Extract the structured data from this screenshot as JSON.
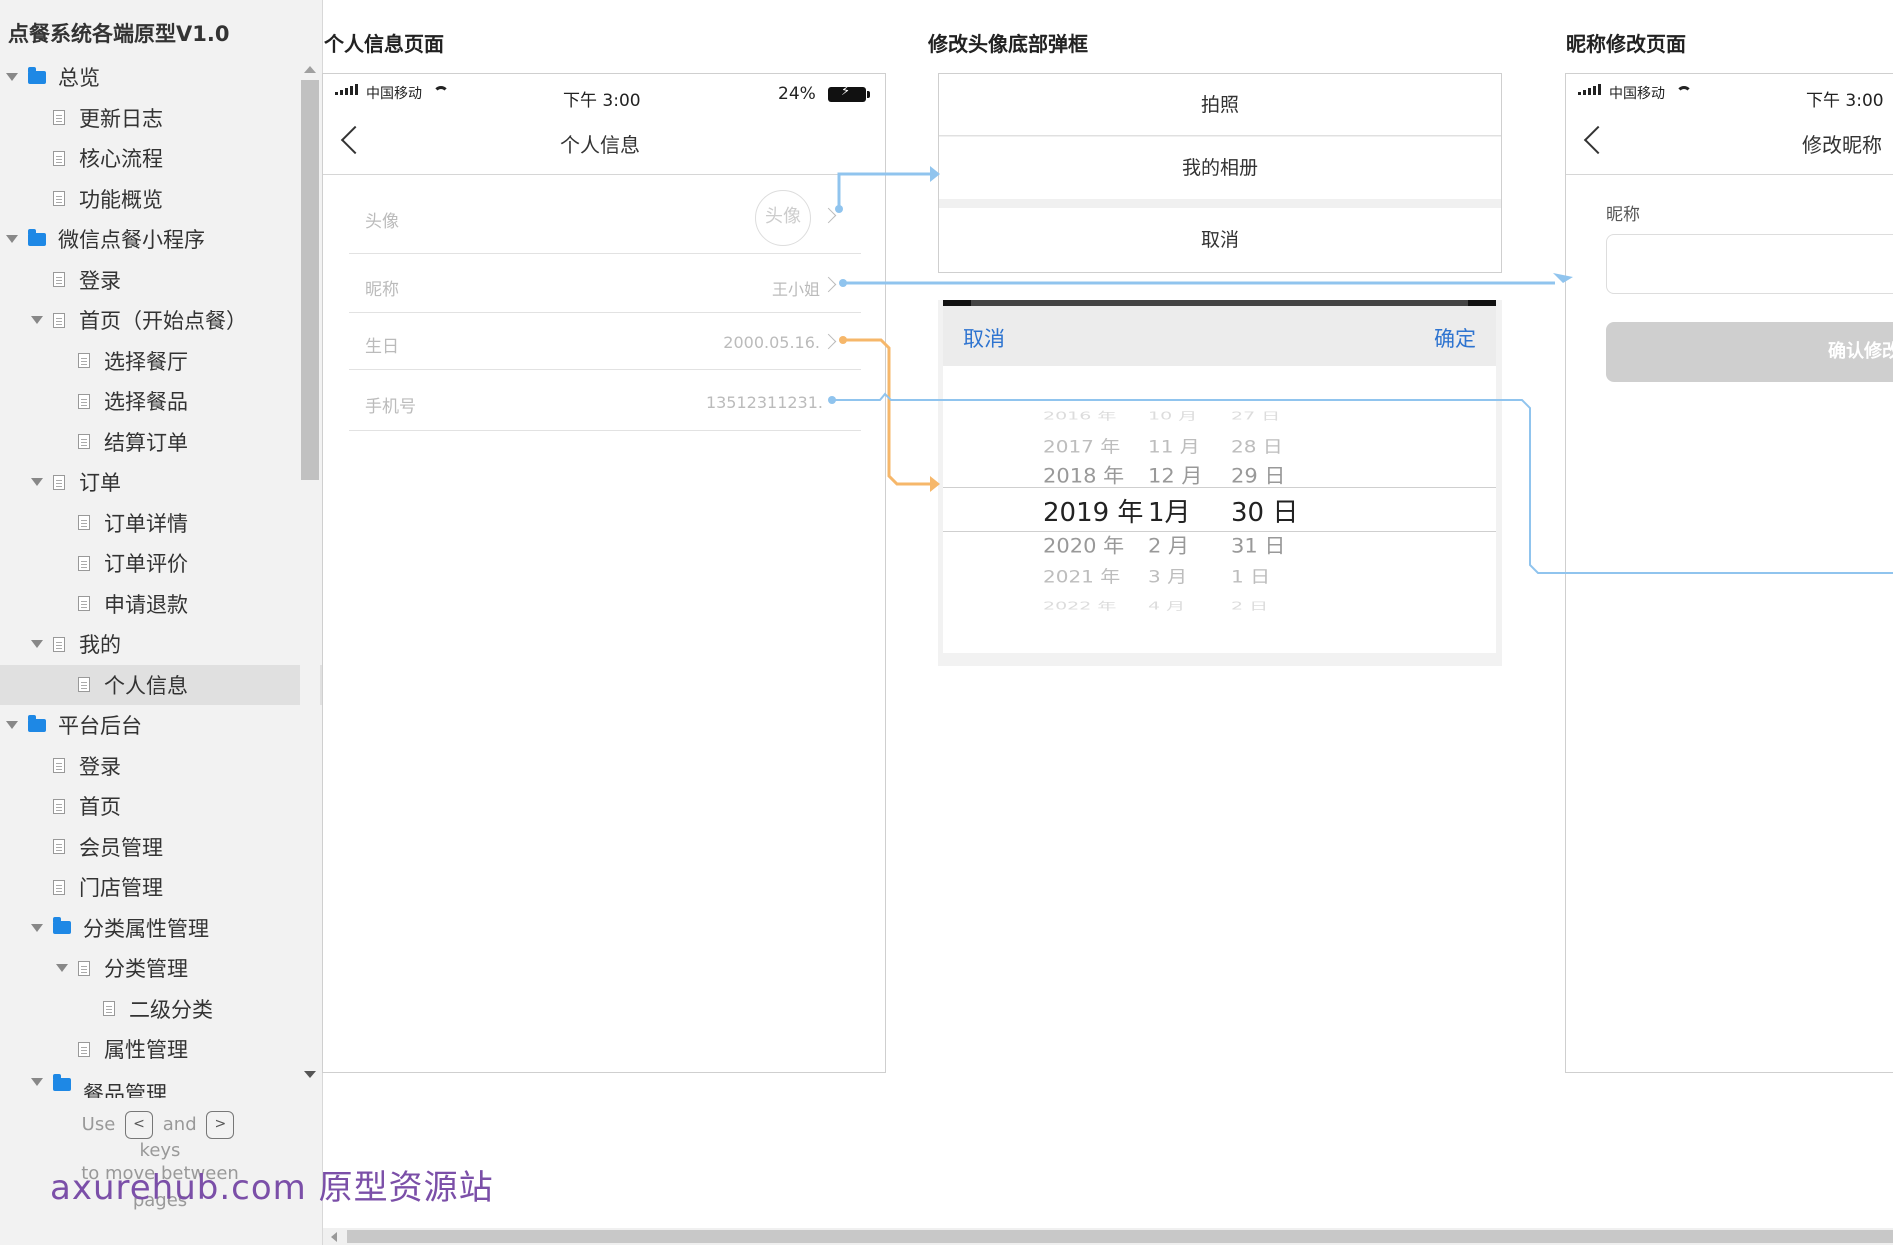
{
  "app": {
    "title": "点餐系统各端原型V1.0"
  },
  "sidebar": {
    "items": [
      {
        "label": "总览",
        "type": "folder",
        "level": 0,
        "expanded": true
      },
      {
        "label": "更新日志",
        "type": "page",
        "level": 1
      },
      {
        "label": "核心流程",
        "type": "page",
        "level": 1
      },
      {
        "label": "功能概览",
        "type": "page",
        "level": 1
      },
      {
        "label": "微信点餐小程序",
        "type": "folder",
        "level": 0,
        "expanded": true
      },
      {
        "label": "登录",
        "type": "page",
        "level": 1
      },
      {
        "label": "首页（开始点餐）",
        "type": "page",
        "level": 1,
        "expanded": true
      },
      {
        "label": "选择餐厅",
        "type": "page",
        "level": 2
      },
      {
        "label": "选择餐品",
        "type": "page",
        "level": 2
      },
      {
        "label": "结算订单",
        "type": "page",
        "level": 2
      },
      {
        "label": "订单",
        "type": "page",
        "level": 1,
        "expanded": true
      },
      {
        "label": "订单详情",
        "type": "page",
        "level": 2
      },
      {
        "label": "订单评价",
        "type": "page",
        "level": 2
      },
      {
        "label": "申请退款",
        "type": "page",
        "level": 2
      },
      {
        "label": "我的",
        "type": "page",
        "level": 1,
        "expanded": true
      },
      {
        "label": "个人信息",
        "type": "page",
        "level": 2,
        "selected": true
      },
      {
        "label": "平台后台",
        "type": "folder",
        "level": 0,
        "expanded": true
      },
      {
        "label": "登录",
        "type": "page",
        "level": 1
      },
      {
        "label": "首页",
        "type": "page",
        "level": 1
      },
      {
        "label": "会员管理",
        "type": "page",
        "level": 1
      },
      {
        "label": "门店管理",
        "type": "page",
        "level": 1
      },
      {
        "label": "分类属性管理",
        "type": "folder",
        "level": 1,
        "expanded": true
      },
      {
        "label": "分类管理",
        "type": "page",
        "level": 2,
        "expanded": true
      },
      {
        "label": "二级分类",
        "type": "page",
        "level": 3
      },
      {
        "label": "属性管理",
        "type": "page",
        "level": 2
      },
      {
        "label": "餐品管理",
        "type": "folder",
        "level": 1,
        "expanded": true
      }
    ],
    "help": {
      "use": "Use",
      "and": "and",
      "keys": "keys",
      "to_move": "to move between",
      "pages": "pages",
      "key_left": "<",
      "key_right": ">"
    }
  },
  "watermark": "axurehub.com 原型资源站",
  "sections": {
    "profile": "个人信息页面",
    "avatar_sheet": "修改头像底部弹框",
    "nickname": "昵称修改页面"
  },
  "profile_page": {
    "status": {
      "carrier": "中国移动",
      "time": "下午 3:00",
      "battery": "24%"
    },
    "nav_title": "个人信息",
    "rows": [
      {
        "label": "头像",
        "value": "头像"
      },
      {
        "label": "昵称",
        "value": "王小姐"
      },
      {
        "label": "生日",
        "value": "2000.05.16."
      },
      {
        "label": "手机号",
        "value": "13512311231."
      }
    ]
  },
  "avatar_sheet": {
    "take_photo": "拍照",
    "album": "我的相册",
    "cancel": "取消"
  },
  "date_picker": {
    "cancel": "取消",
    "confirm": "确定",
    "rows": [
      {
        "year": "2016 年",
        "month": "10 月",
        "day": "27 日"
      },
      {
        "year": "2017 年",
        "month": "11 月",
        "day": "28 日"
      },
      {
        "year": "2018 年",
        "month": "12 月",
        "day": "29 日"
      },
      {
        "year": "2019 年",
        "month": "1月",
        "day": "30 日"
      },
      {
        "year": "2020 年",
        "month": "2 月",
        "day": "31 日"
      },
      {
        "year": "2021 年",
        "month": "3 月",
        "day": "1 日"
      },
      {
        "year": "2022 年",
        "month": "4 月",
        "day": "2 日"
      }
    ],
    "selected_index": 3
  },
  "nickname_page": {
    "status": {
      "carrier": "中国移动",
      "time": "下午 3:00"
    },
    "nav_title": "修改昵称",
    "field_label": "昵称",
    "input_value": "",
    "confirm_button": "确认修改"
  },
  "colors": {
    "accent_blue": "#2e74d0",
    "connector_blue": "#90c4ee",
    "connector_orange": "#f6b76a",
    "folder_blue": "#1e88e5"
  }
}
